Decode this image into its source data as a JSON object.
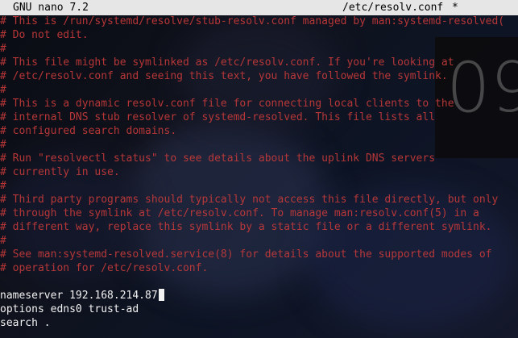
{
  "titlebar": {
    "app": "GNU nano 7.2",
    "file": "/etc/resolv.conf",
    "modified_marker": "*"
  },
  "clock": {
    "digits": "09"
  },
  "buffer": {
    "comment_lines": [
      "# This is /run/systemd/resolve/stub-resolv.conf managed by man:systemd-resolved(",
      "# Do not edit.",
      "#",
      "# This file might be symlinked as /etc/resolv.conf. If you're looking at",
      "# /etc/resolv.conf and seeing this text, you have followed the symlink.",
      "#",
      "# This is a dynamic resolv.conf file for connecting local clients to the",
      "# internal DNS stub resolver of systemd-resolved. This file lists all",
      "# configured search domains.",
      "#",
      "# Run \"resolvectl status\" to see details about the uplink DNS servers",
      "# currently in use.",
      "#",
      "# Third party programs should typically not access this file directly, but only",
      "# through the symlink at /etc/resolv.conf. To manage man:resolv.conf(5) in a",
      "# different way, replace this symlink by a static file or a different symlink.",
      "#",
      "# See man:systemd-resolved.service(8) for details about the supported modes of",
      "# operation for /etc/resolv.conf."
    ],
    "config_lines": [
      "nameserver 192.168.214.87",
      "options edns0 trust-ad",
      "search ."
    ]
  },
  "colors": {
    "comment": "#c43a3a",
    "text": "#f2f2f2",
    "titlebar_bg": "#e6e6e6"
  }
}
